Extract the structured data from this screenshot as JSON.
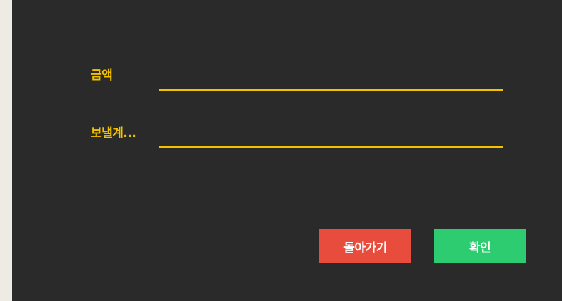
{
  "form": {
    "amount_label": "금액",
    "amount_value": "",
    "recipient_label": "보낼계...",
    "recipient_value": ""
  },
  "actions": {
    "back_label": "돌아가기",
    "confirm_label": "확인"
  },
  "colors": {
    "background": "#2A2A2A",
    "accent": "#F2C200",
    "back_button": "#E74C3C",
    "confirm_button": "#2ECC71"
  }
}
